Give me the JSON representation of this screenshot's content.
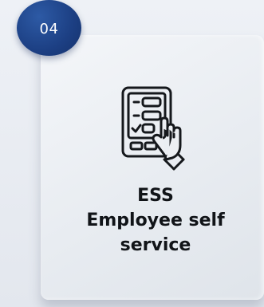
{
  "card": {
    "number": "04",
    "acronym": "ESS",
    "title_line1": "Employee self",
    "title_line2": "service"
  },
  "icon": "touch-screen-checklist-icon",
  "colors": {
    "badge": "#1c3f83",
    "text": "#111418",
    "card": "#eceff3"
  }
}
